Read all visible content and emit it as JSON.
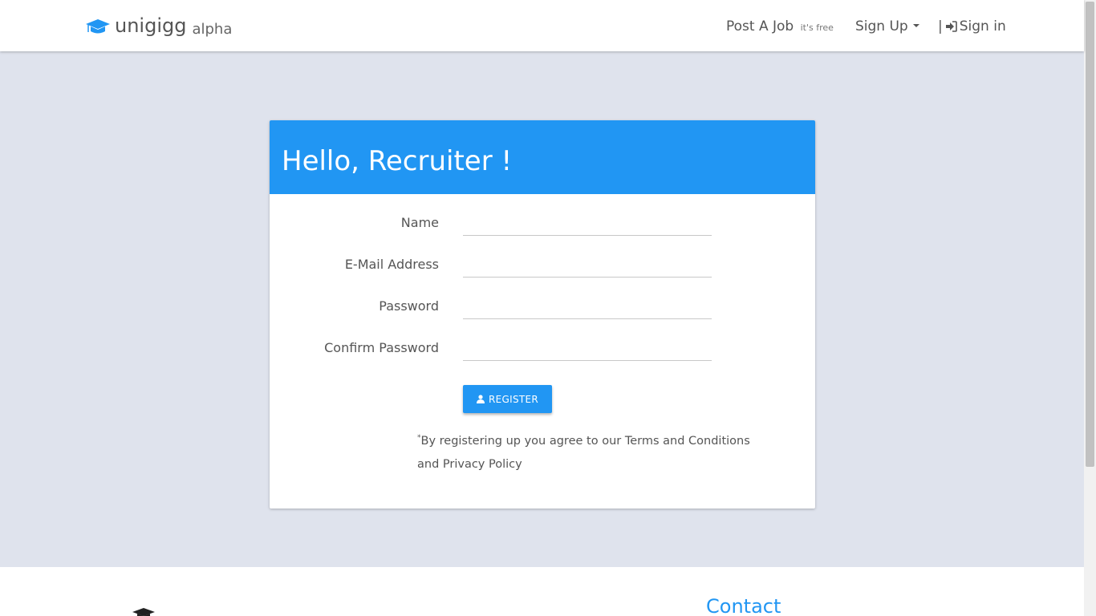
{
  "brand": {
    "name": "unigigg",
    "tag": "alpha",
    "icon": "graduation-cap-icon",
    "accent": "#2196f3"
  },
  "nav": {
    "post_job": "Post A Job",
    "post_job_note": "it's free",
    "sign_up": "Sign Up",
    "sign_in_separator": "|",
    "sign_in": "Sign in"
  },
  "card": {
    "title": "Hello, Recruiter !",
    "header_color": "#2196f3",
    "fields": [
      {
        "label": "Name",
        "value": ""
      },
      {
        "label": "E-Mail Address",
        "value": ""
      },
      {
        "label": "Password",
        "value": ""
      },
      {
        "label": "Confirm Password",
        "value": ""
      }
    ],
    "register_label": "REGISTER",
    "terms_mark": "*",
    "terms_line1": "By registering up you agree to our Terms and Conditions",
    "terms_line2": "and Privacy Policy"
  },
  "footer": {
    "contact_heading": "Contact"
  }
}
